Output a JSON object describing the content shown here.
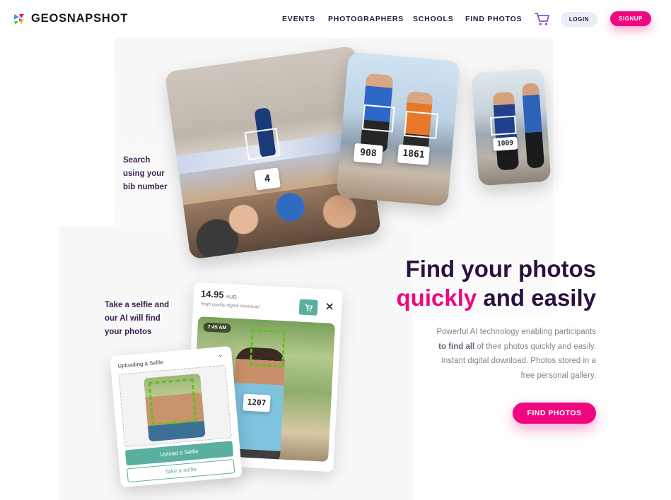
{
  "brand": {
    "name": "GEOSNAPSHOT"
  },
  "nav": {
    "items": [
      "EVENTS",
      "PHOTOGRAPHERS",
      "SCHOOLS",
      "FIND PHOTOS"
    ],
    "login": "LOGIN",
    "signup": "SIGNUP",
    "cart_icon": "cart-icon"
  },
  "colors": {
    "accent": "#f0077f",
    "heading": "#2a1140",
    "teal": "#5ab09e",
    "face_box": "#5dc21e"
  },
  "hero": {
    "title_line1": "Find your photos",
    "title_pink": "quickly",
    "title_rest": " and easily",
    "desc_line1": "Powerful AI technology enabling participants",
    "desc_bold": "to find all",
    "desc_line2_rest": " of their photos quickly and easily.",
    "desc_line3": "Instant digital download. Photos stored in a",
    "desc_line4": "free personal gallery.",
    "cta": "FIND PHOTOS"
  },
  "captions": {
    "bib": [
      "Search",
      "using your",
      "bib number"
    ],
    "selfie": [
      "Take a selfie and",
      "our AI will find",
      "your photos"
    ]
  },
  "bibs": {
    "card1": "4",
    "card2a": "908",
    "card2b": "1861",
    "card3": "1009",
    "runner": "1207"
  },
  "product": {
    "price": "14.95",
    "currency": "AUD",
    "subtitle": "*high quality digital download",
    "time": "7:45 AM",
    "cart_icon": "cart-icon",
    "close_icon": "close-icon"
  },
  "upload": {
    "title": "Uploading a Selfie",
    "upload_btn": "Upload a Selfie",
    "take_btn": "Take a selfie"
  }
}
